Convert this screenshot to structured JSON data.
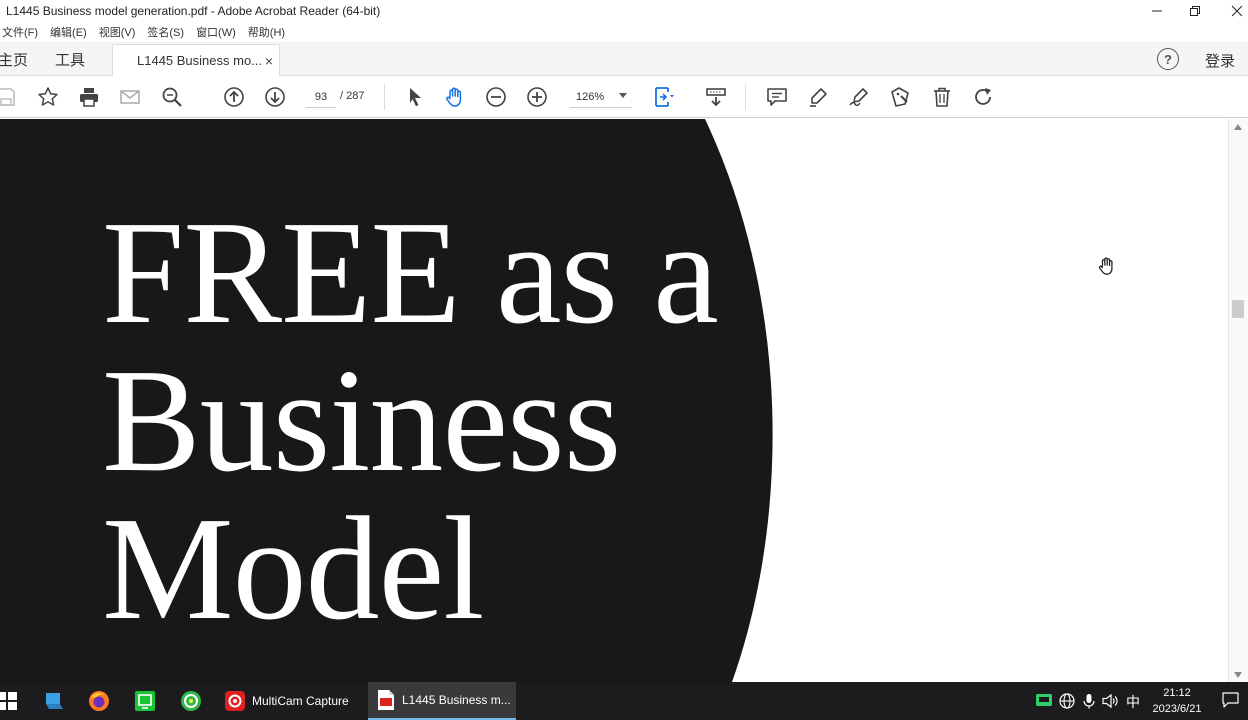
{
  "window": {
    "title": "L1445 Business model generation.pdf - Adobe Acrobat Reader (64-bit)"
  },
  "menu": [
    "文件(F)",
    "编辑(E)",
    "视图(V)",
    "签名(S)",
    "窗口(W)",
    "帮助(H)"
  ],
  "tabs": {
    "home": "主页",
    "tools": "工具",
    "document": "L1445 Business mo...",
    "close": "×"
  },
  "header_right": {
    "help": "?",
    "login": "登录"
  },
  "toolbar": {
    "page_current": "93",
    "page_total": "/ 287",
    "zoom": "126%",
    "icons": [
      "save-icon",
      "star-icon",
      "print-icon",
      "mail-icon",
      "zoom-search-icon",
      "page-up-icon",
      "page-down-icon",
      "select-arrow-icon",
      "hand-icon",
      "zoom-out-icon",
      "zoom-in-icon",
      "fit-page-icon",
      "scroll-mode-icon",
      "comment-icon",
      "highlight-icon",
      "sign-icon",
      "edit-stamp-icon",
      "delete-icon",
      "rotate-icon"
    ]
  },
  "document": {
    "page_bg_color": "#18171a",
    "text_color": "#ffffff",
    "lines": [
      "FREE as a",
      "Business",
      "Model"
    ]
  },
  "taskbar": {
    "apps": [
      {
        "label": "MultiCam Capture"
      },
      {
        "label": "L1445 Business m..."
      }
    ],
    "ime": "中",
    "time": "21:12",
    "date": "2023/6/21"
  }
}
